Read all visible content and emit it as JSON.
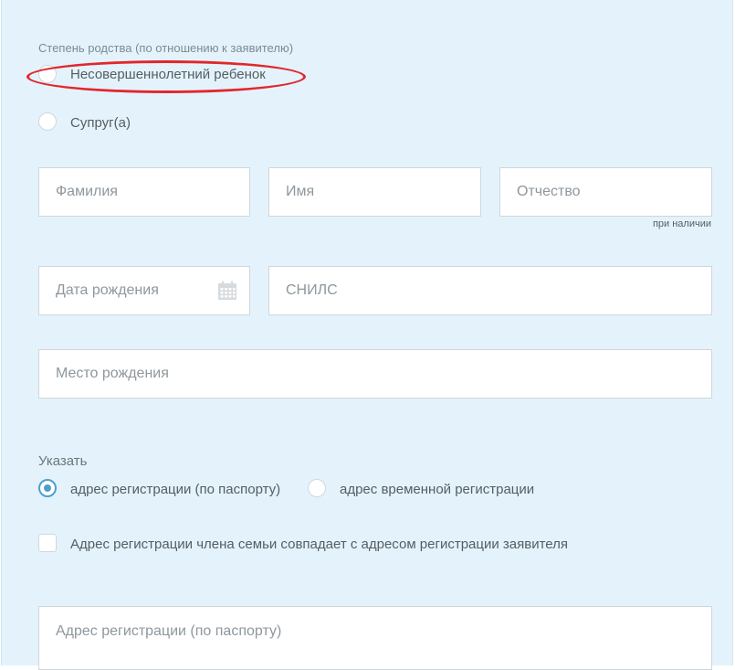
{
  "relation": {
    "label": "Степень родства (по отношению к заявителю)",
    "options": [
      {
        "label": "Несовершеннолетний ребенок",
        "checked": false,
        "highlighted": true
      },
      {
        "label": "Супруг(а)",
        "checked": false
      }
    ]
  },
  "fields": {
    "surname": {
      "placeholder": "Фамилия"
    },
    "name": {
      "placeholder": "Имя"
    },
    "patronymic": {
      "placeholder": "Отчество",
      "hint": "при наличии"
    },
    "birth_date": {
      "placeholder": "Дата рождения"
    },
    "snils": {
      "placeholder": "СНИЛС"
    },
    "birth_place": {
      "placeholder": "Место рождения"
    },
    "reg_address": {
      "placeholder": "Адрес регистрации (по паспорту)"
    }
  },
  "address_type": {
    "label": "Указать",
    "options": [
      {
        "label": "адрес регистрации (по паспорту)",
        "checked": true
      },
      {
        "label": "адрес временной регистрации",
        "checked": false
      }
    ]
  },
  "same_address": {
    "label": "Адрес регистрации члена семьи совпадает с адресом регистрации заявителя",
    "checked": false
  },
  "colors": {
    "panel_bg": "#e4f3fb",
    "accent": "#4e9fcf",
    "highlight": "#e3262d"
  },
  "icons": {
    "birth_date": "calendar-icon"
  }
}
